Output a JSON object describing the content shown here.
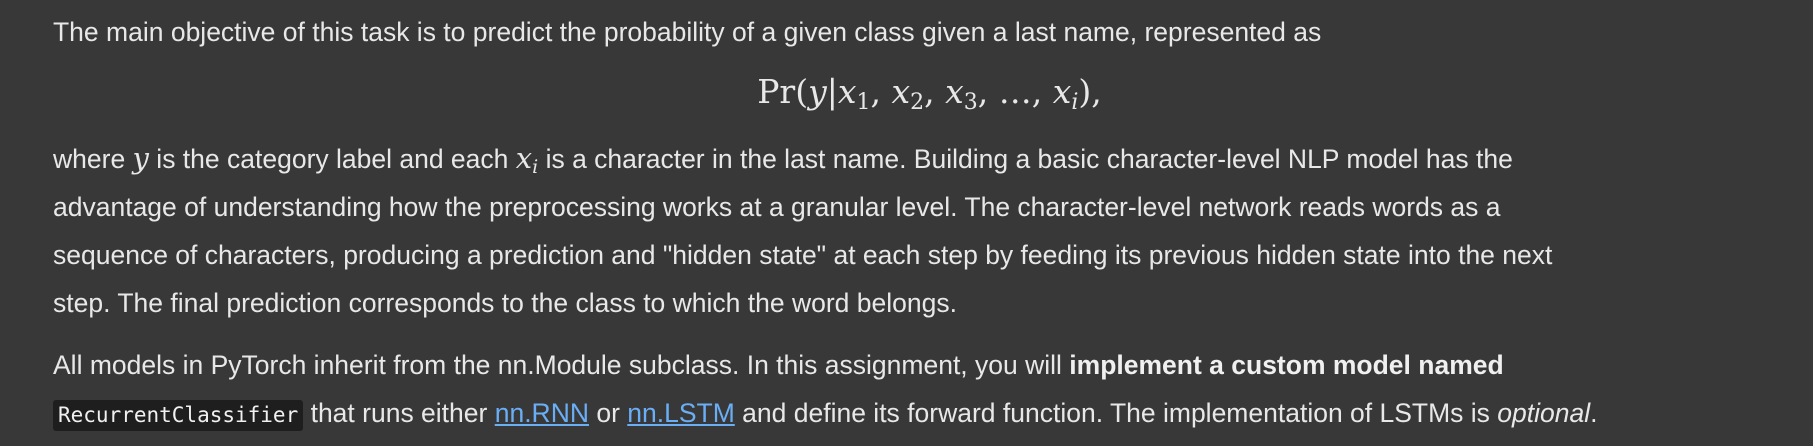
{
  "intro": {
    "text": "The main objective of this task is to predict the probability of a given class given a last name, represented as"
  },
  "formula": {
    "func": "Pr",
    "open": "(",
    "y": "y",
    "bar": "|",
    "x": "x",
    "sub1": "1",
    "sub2": "2",
    "sub3": "3",
    "dots": "…",
    "subi": "i",
    "close": "),",
    "comma": ","
  },
  "para2": {
    "where": "where ",
    "y_var": "y",
    "mid1": " is the category label and each ",
    "x_var": "x",
    "x_sub": "i",
    "rest1": " is a character in the last name. Building a basic character-level NLP model has the",
    "line2": "advantage of understanding how the preprocessing works at a granular level. The character-level network reads words as a",
    "line3": "sequence of characters, producing a prediction and \"hidden state\" at each step by feeding its previous hidden state into the next",
    "line4": "step. The final prediction corresponds to the class to which the word belongs."
  },
  "para3": {
    "start": "All models in PyTorch inherit from the nn.Module subclass. In this assignment, you will ",
    "bold": "implement a custom model named",
    "code": "RecurrentClassifier",
    "mid1": " that runs either ",
    "link_rnn": "nn.RNN",
    "mid2": " or ",
    "link_lstm": "nn.LSTM",
    "mid3": " and define its forward function. The implementation of LSTMs is ",
    "italic": "optional",
    "end": "."
  },
  "colors": {
    "background": "#383838",
    "text": "#e8e8e8",
    "link": "#6aaef5",
    "code_bg": "#1e1e1e"
  }
}
